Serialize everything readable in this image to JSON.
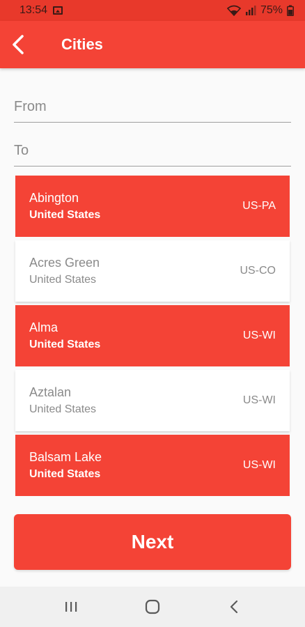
{
  "status_bar": {
    "time": "13:54",
    "battery": "75%"
  },
  "app_bar": {
    "title": "Cities",
    "back_icon": "back-arrow-icon"
  },
  "form": {
    "from": {
      "placeholder": "From",
      "value": ""
    },
    "to": {
      "placeholder": "To",
      "value": ""
    }
  },
  "cities": [
    {
      "name": "Abington",
      "country": "United States",
      "code": "US-PA",
      "selected": true
    },
    {
      "name": "Acres Green",
      "country": "United States",
      "code": "US-CO",
      "selected": false
    },
    {
      "name": "Alma",
      "country": "United States",
      "code": "US-WI",
      "selected": true
    },
    {
      "name": "Aztalan",
      "country": "United States",
      "code": "US-WI",
      "selected": false
    },
    {
      "name": "Balsam Lake",
      "country": "United States",
      "code": "US-WI",
      "selected": true
    }
  ],
  "next_button": {
    "label": "Next"
  },
  "nav_bar": {
    "recents_icon": "recents-icon",
    "home_icon": "home-icon",
    "back_icon": "back-icon"
  },
  "colors": {
    "accent": "#f44336",
    "status_bar": "#e8392b",
    "card_unselected": "#ffffff",
    "text_muted": "#8a8a8a"
  }
}
